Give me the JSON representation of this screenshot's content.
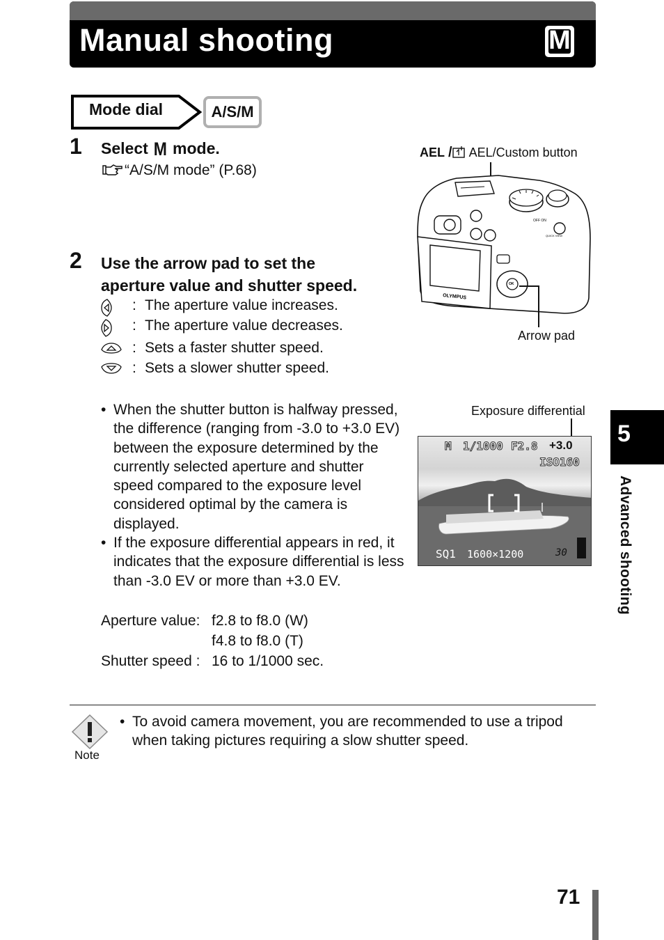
{
  "header": {
    "title": "Manual shooting",
    "mode_icon_letter": "M"
  },
  "mode_dial": {
    "label": "Mode dial",
    "setting": "A/S/M"
  },
  "steps": [
    {
      "number": "1",
      "title_before": "Select ",
      "title_icon_letter": "M",
      "title_after": " mode.",
      "reference": "“A/S/M mode” (P.68)"
    },
    {
      "number": "2",
      "title_line1": "Use the arrow pad to set the",
      "title_line2": "aperture value and shutter speed.",
      "arrow_actions": [
        {
          "icon": "arrow-left-icon",
          "colon": ":",
          "text": "The aperture value increases."
        },
        {
          "icon": "arrow-right-icon",
          "colon": ":",
          "text": "The aperture value decreases."
        },
        {
          "icon": "arrow-up-icon",
          "colon": ":",
          "text": "Sets a faster shutter speed."
        },
        {
          "icon": "arrow-down-icon",
          "colon": ":",
          "text": "Sets a slower shutter speed."
        }
      ],
      "bullets": [
        "When the shutter button is halfway pressed, the difference (ranging from -3.0 to +3.0 EV) between the exposure determined by the currently selected aperture and shutter speed compared to the exposure level considered optimal by the camera is displayed.",
        "If the exposure differential appears in red, it indicates that the exposure differential is less than -3.0 EV or more than +3.0 EV."
      ],
      "specs": [
        {
          "label": "Aperture value:",
          "value": "f2.8 to f8.0 (W)"
        },
        {
          "label": "",
          "value": "f4.8 to f8.0 (T)"
        },
        {
          "label": "Shutter speed :",
          "value": "16 to 1/1000 sec."
        }
      ]
    }
  ],
  "camera_figure": {
    "ael_prefix": "AEL",
    "ael_label": "AEL/Custom button",
    "arrow_pad_label": "Arrow pad",
    "brand": "OLYMPUS",
    "ok_label": "OK"
  },
  "lcd_figure": {
    "callout": "Exposure differential",
    "mode": "M",
    "shutter": "1/1000",
    "aperture": "F2.8",
    "exposure_diff": "+3.0",
    "iso": "ISO160",
    "quality": "SQ1",
    "resolution": "1600×1200",
    "shots_remaining": "30"
  },
  "note": {
    "label": "Note",
    "bullet": "•",
    "text": "To avoid camera movement, you are recommended to use a tripod when taking pictures requiring a slow shutter speed."
  },
  "chapter": {
    "number": "5",
    "title": "Advanced shooting"
  },
  "page_number": "71",
  "bullet_char": "•"
}
